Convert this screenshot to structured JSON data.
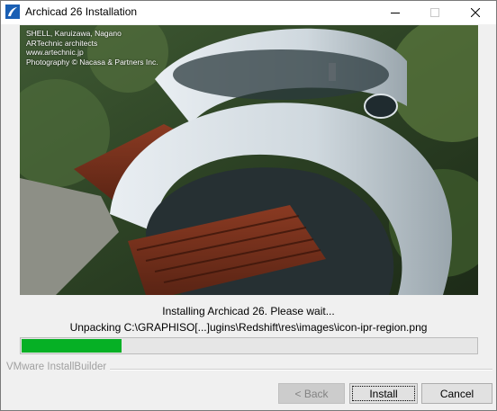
{
  "window": {
    "title": "Archicad 26 Installation"
  },
  "banner": {
    "credit_lines": [
      "SHELL, Karuizawa, Nagano",
      "ARTechnic architects",
      "www.artechnic.jp",
      "Photography © Nacasa & Partners Inc."
    ]
  },
  "status": {
    "message": "Installing Archicad 26. Please wait...",
    "file": "Unpacking C:\\GRAPHISO[...]ugins\\Redshift\\res\\images\\icon-ipr-region.png"
  },
  "progress": {
    "percent": 22,
    "color": "#06b025"
  },
  "footer": {
    "brand": "VMware InstallBuilder"
  },
  "buttons": {
    "back": "< Back",
    "install": "Install",
    "cancel": "Cancel"
  },
  "icons": {
    "app": "archicad-app-icon",
    "minimize": "minimize-icon",
    "maximize": "maximize-icon",
    "close": "close-icon"
  }
}
